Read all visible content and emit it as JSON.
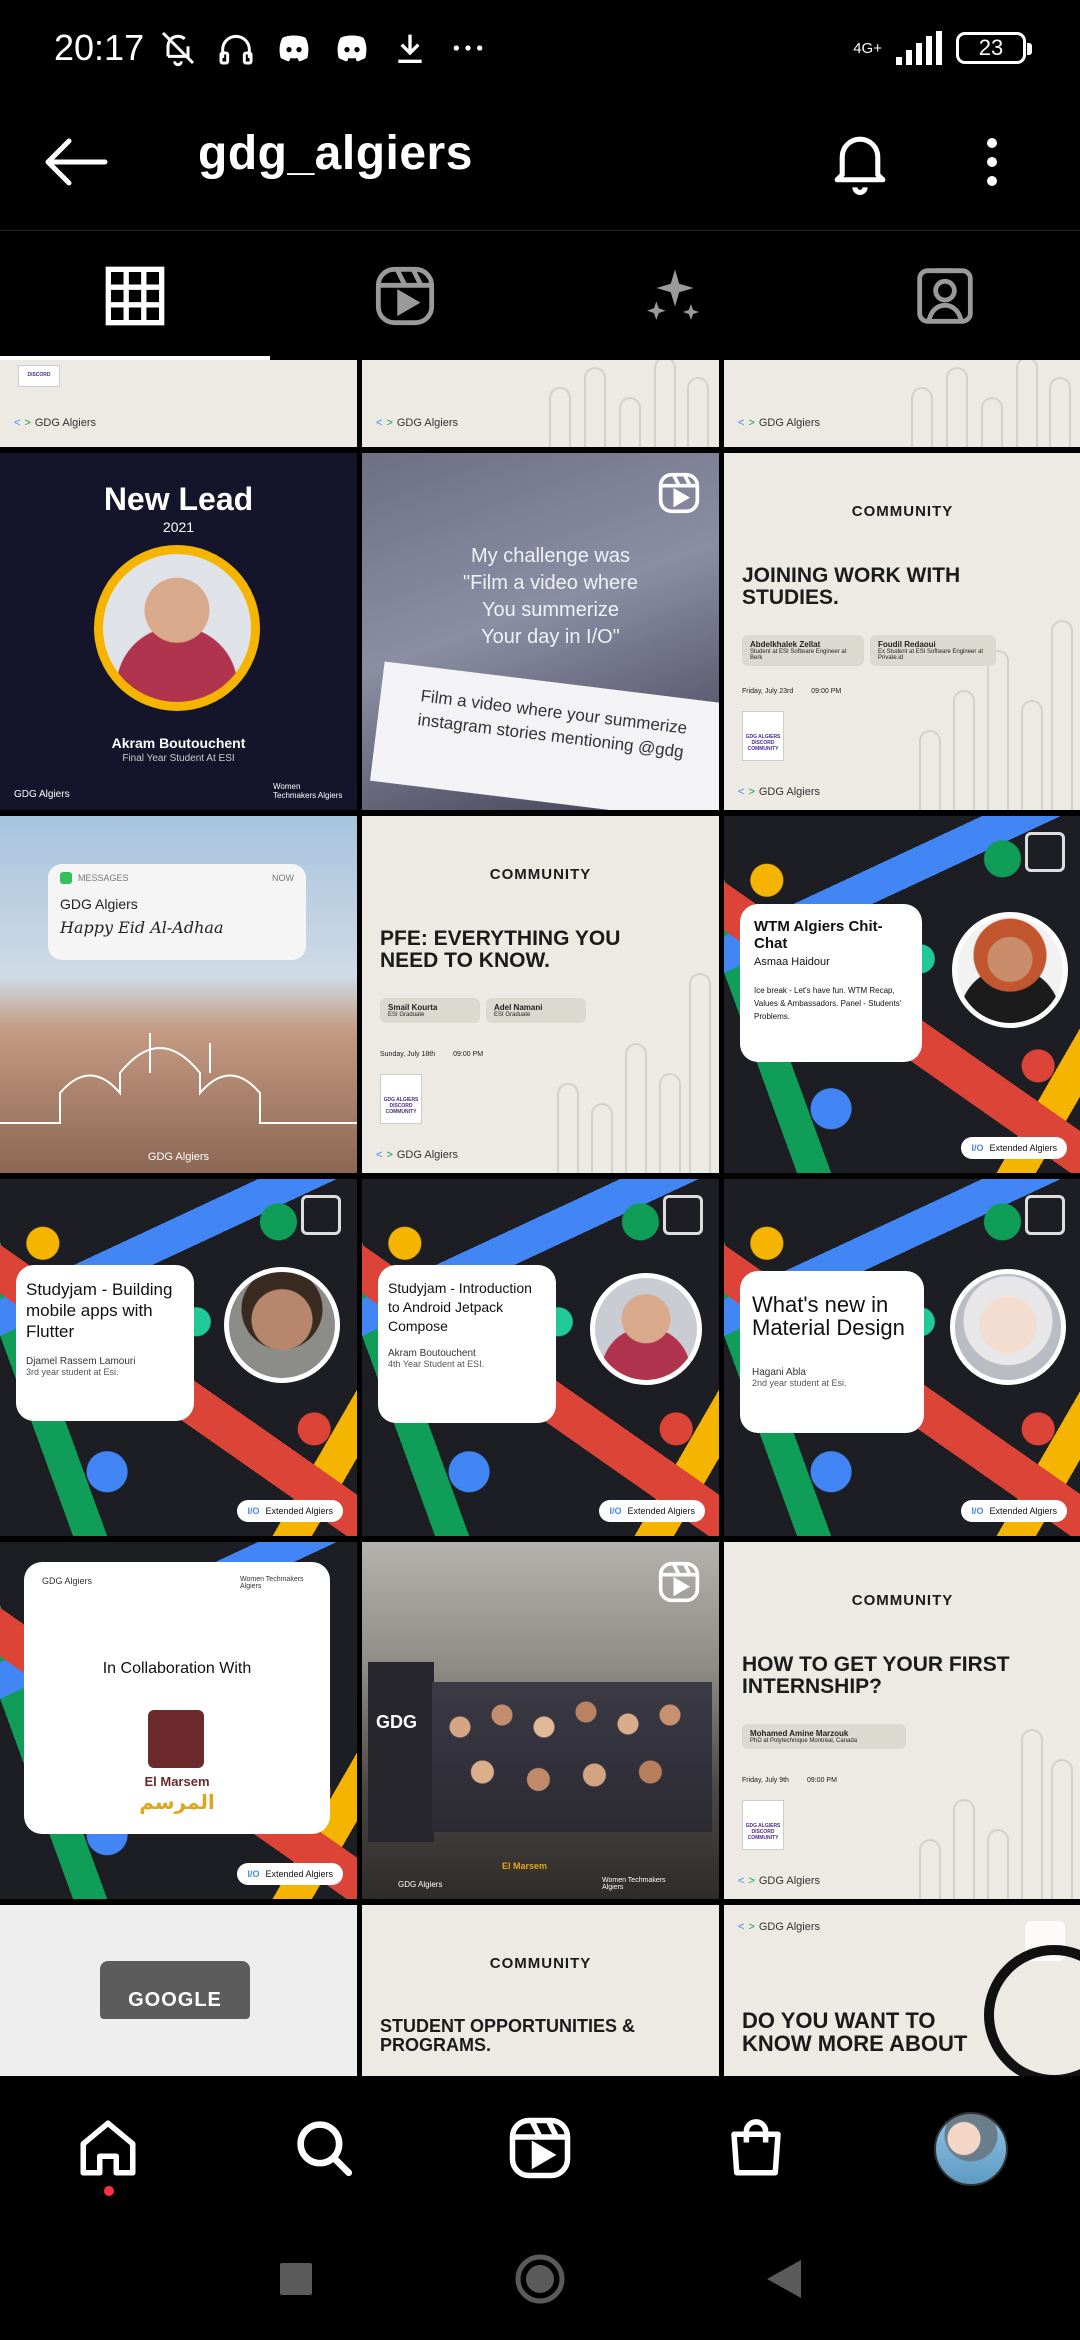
{
  "status_bar": {
    "time": "20:17",
    "network": "4G+",
    "battery": "23"
  },
  "header": {
    "title": "gdg_algiers"
  },
  "tabs": [
    "posts",
    "reels",
    "guides",
    "tagged"
  ],
  "grid": {
    "row0": [
      "GDG Algiers",
      "GDG Algiers",
      "GDG Algiers"
    ],
    "new_lead": {
      "title": "New Lead",
      "year": "2021",
      "name": "Akram Boutouchent",
      "role": "Final Year Student At ESI",
      "left_brand": "GDG Algiers",
      "right_brand": "Women Techmakers Algiers"
    },
    "challenge": {
      "line1": "My challenge was",
      "line2": "\"Film a video where",
      "line3": "You summerize",
      "line4": "Your day in I/O\"",
      "paper": "Film a video where your summerize instagram stories mentioning @gdg"
    },
    "joining": {
      "community": "COMMUNITY",
      "headline": "JOINING WORK WITH STUDIES.",
      "speaker1": "Abdelkhalek Zellat",
      "speaker1_role": "Student at ESI Software Engineer at Berk",
      "speaker2": "Foudil Redaoui",
      "speaker2_role": "Ex Student at ESI Software Engineer at Private.id",
      "date": "Friday, July 23rd",
      "time": "09:00 PM",
      "discord": "GDG ALGIERS DISCORD COMMUNITY",
      "brand": "GDG Algiers"
    },
    "eid": {
      "app": "MESSAGES",
      "when": "NOW",
      "sender": "GDG Algiers",
      "message": "Happy Eid Al-Adhaa",
      "brand": "GDG Algiers"
    },
    "pfe": {
      "community": "COMMUNITY",
      "headline": "PFE: EVERYTHING YOU NEED TO KNOW.",
      "speaker1": "Smail Kourta",
      "speaker1_role": "ESI Graduate",
      "speaker2": "Adel Namani",
      "speaker2_role": "ESI Graduate",
      "date": "Sunday, July 18th",
      "time": "09:00 PM",
      "discord": "GDG ALGIERS DISCORD COMMUNITY",
      "brand": "GDG Algiers"
    },
    "wtm": {
      "title": "WTM Algiers Chit-Chat",
      "host": "Asmaa Haidour",
      "agenda": "Ice break - Let's have fun. WTM Recap, Values & Ambassadors. Panel - Students' Problems.",
      "brand": "Extended Algiers"
    },
    "flutter": {
      "title": "Studyjam - Building mobile apps with Flutter",
      "speaker": "Djamel Rassem Lamouri",
      "role": "3rd year student at Esi.",
      "brand": "Extended Algiers"
    },
    "compose": {
      "title": "Studyjam - Introduction to Android Jetpack Compose",
      "speaker": "Akram Boutouchent",
      "role": "4th Year Student at ESI.",
      "brand": "Extended Algiers"
    },
    "material": {
      "title": "What's new in Material Design",
      "speaker": "Hagani Abla",
      "role": "2nd year student at Esi.",
      "brand": "Extended Algiers"
    },
    "collab": {
      "left_brand": "GDG Algiers",
      "right_brand": "Women Techmakers Algiers",
      "text": "In Collaboration With",
      "partner": "El Marsem",
      "partner_ar": "المرسم",
      "brand": "Extended Algiers"
    },
    "group": {
      "banner": "GDG",
      "brand1": "GDG Algiers",
      "brand2": "Women Techmakers Algiers",
      "partner": "El Marsem"
    },
    "internship": {
      "community": "COMMUNITY",
      "headline": "HOW TO GET YOUR FIRST INTERNSHIP?",
      "speaker": "Mohamed Amine Marzouk",
      "speaker_role": "PhD at Polytechnique Montréal, Canada",
      "date": "Friday, July 9th",
      "time": "09:00 PM",
      "discord": "GDG ALGIERS DISCORD COMMUNITY",
      "brand": "GDG Algiers"
    },
    "google": {
      "label": "GOOGLE"
    },
    "opportunities": {
      "community": "COMMUNITY",
      "headline": "STUDENT OPPORTUNITIES & PROGRAMS."
    },
    "know_more": {
      "brand": "GDG Algiers",
      "headline": "DO YOU WANT TO KNOW MORE ABOUT"
    }
  },
  "colors": {
    "blue": "#4285f4",
    "red": "#db4437",
    "yellow": "#f4b400",
    "green": "#0f9d58",
    "notification_dot": "#ff3040"
  }
}
